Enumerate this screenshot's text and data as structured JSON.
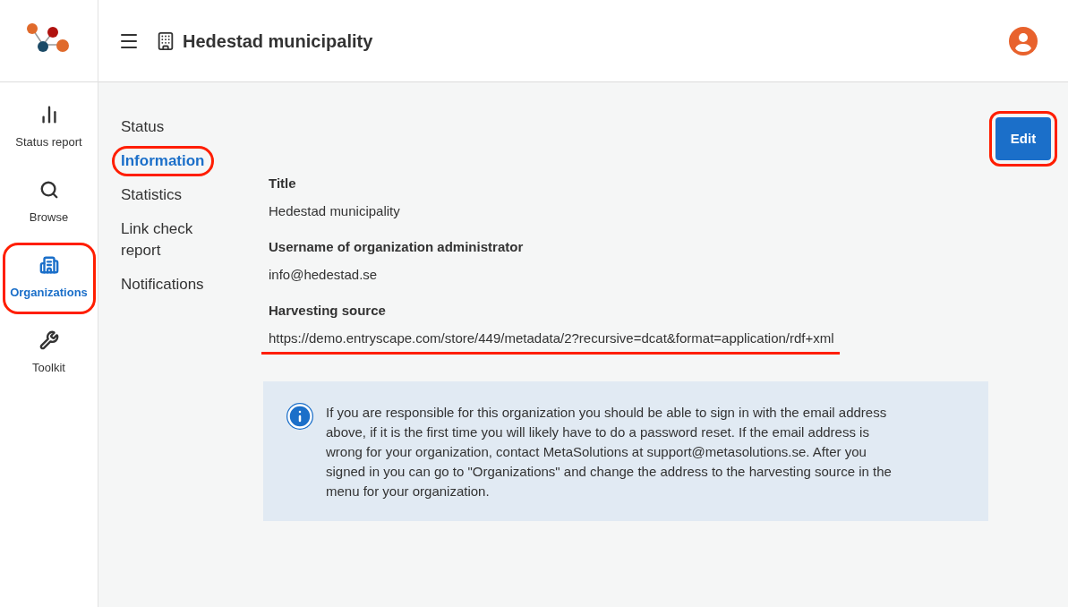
{
  "header": {
    "title": "Hedestad municipality"
  },
  "sidebar": {
    "items": [
      {
        "label": "Status report",
        "selected": false,
        "highlighted": false
      },
      {
        "label": "Browse",
        "selected": false,
        "highlighted": false
      },
      {
        "label": "Organizations",
        "selected": true,
        "highlighted": true
      },
      {
        "label": "Toolkit",
        "selected": false,
        "highlighted": false
      }
    ]
  },
  "subnav": {
    "items": [
      {
        "label": "Status",
        "selected": false,
        "highlighted": false
      },
      {
        "label": "Information",
        "selected": true,
        "highlighted": true
      },
      {
        "label": "Statistics",
        "selected": false,
        "highlighted": false
      },
      {
        "label": "Link check report",
        "selected": false,
        "highlighted": false
      },
      {
        "label": "Notifications",
        "selected": false,
        "highlighted": false
      }
    ]
  },
  "edit_button": {
    "label": "Edit",
    "highlighted": true
  },
  "fields": [
    {
      "label": "Title",
      "value": "Hedestad municipality",
      "underlined": false
    },
    {
      "label": "Username of organization administrator",
      "value": "info@hedestad.se",
      "underlined": false
    },
    {
      "label": "Harvesting source",
      "value": "https://demo.entryscape.com/store/449/metadata/2?recursive=dcat&format=application/rdf+xml",
      "underlined": true
    }
  ],
  "info_box": {
    "text": "If you are responsible for this organization you should be able to sign in with the email address above, if it is the first time you will likely have to do a password reset. If the email address is wrong for your organization, contact MetaSolutions at support@metasolutions.se. After you signed in you can go to \"Organizations\" and change the address to the harvesting source in the menu for your organization."
  }
}
